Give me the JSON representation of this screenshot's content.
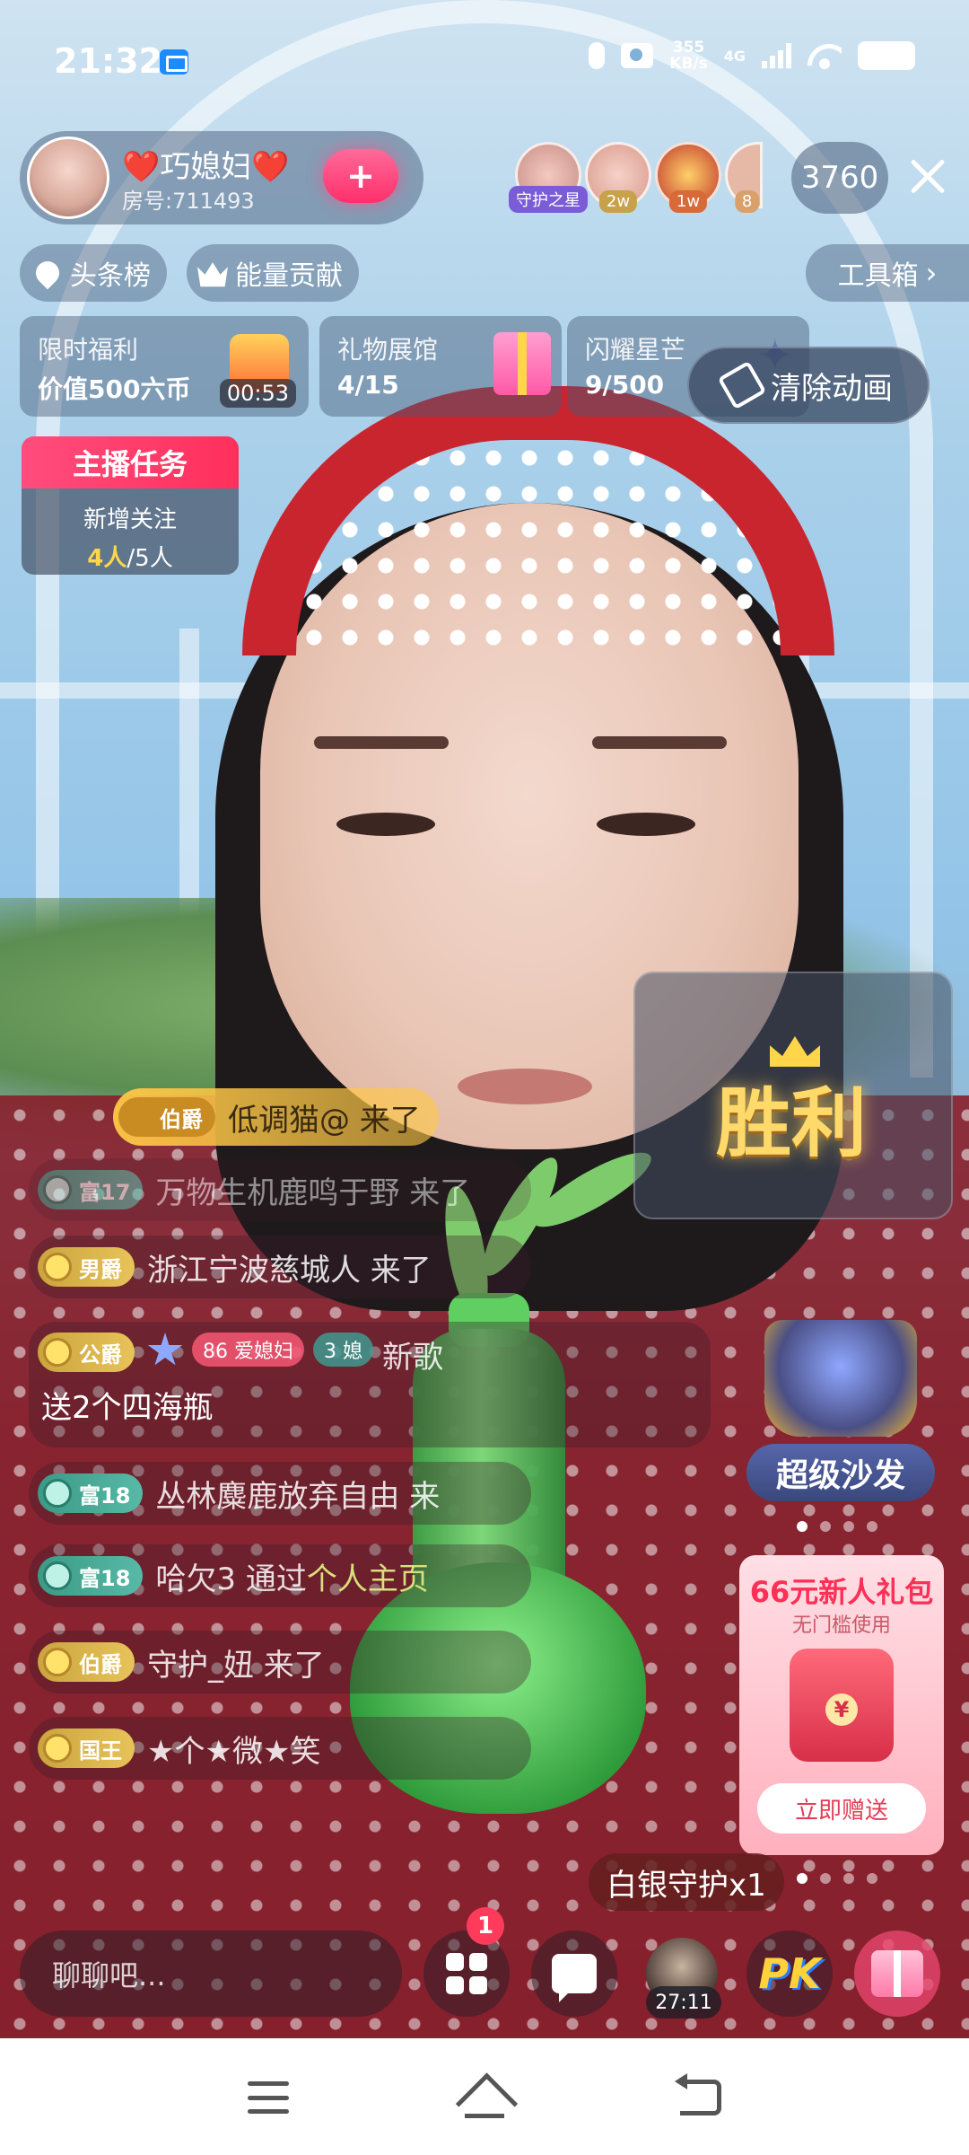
{
  "status_bar": {
    "time": "21:32",
    "net_speed": "355\nKB/s",
    "net_type": "4G",
    "icons": [
      "cast-icon",
      "mic-icon",
      "camera-icon",
      "signal-icon",
      "wifi-icon",
      "battery-icon"
    ]
  },
  "host": {
    "name": "❤️巧媳妇❤️",
    "room_id": "房号:711493",
    "follow_label": "+"
  },
  "top_viewers": [
    {
      "badge": "守护之星",
      "color": "#7a5cd6"
    },
    {
      "badge": "2w",
      "color": "#c7a24a"
    },
    {
      "badge": "1w",
      "color": "#d86a3a"
    },
    {
      "badge": "8",
      "color": "#d9a06a"
    }
  ],
  "viewer_count": "3760",
  "rank_row": {
    "headline": "头条榜",
    "energy": "能量贡献",
    "toolbox": "工具箱"
  },
  "cards": [
    {
      "title": "限时福利",
      "sub": "价值500六币",
      "timer": "00:53"
    },
    {
      "title": "礼物展馆",
      "sub": "4/15"
    },
    {
      "title": "闪耀星芒",
      "sub": "9/500"
    }
  ],
  "clear_animation": "清除动画",
  "host_task": {
    "title": "主播任务",
    "label": "新增关注",
    "progress_current": "4人",
    "progress_total": "/5人"
  },
  "victory": "胜利",
  "arrival": {
    "level": "伯爵",
    "text": "低调猫@ 来了"
  },
  "chat": [
    {
      "level": "富17",
      "style": "teal",
      "text": "万物生机鹿鸣于野 来了"
    },
    {
      "level": "男爵",
      "style": "gold",
      "text": "浙江宁波慈城人 来了"
    },
    {
      "level": "公爵",
      "style": "gold",
      "fan1": "86 爱媳妇",
      "fan2": "3 媳",
      "text": "新歌"
    },
    {
      "level": "富18",
      "style": "teal",
      "text": "丛林麋鹿放弃自由 来"
    },
    {
      "level": "富18",
      "style": "teal",
      "text": "哈欠3 通过 ",
      "extra": "个人主页"
    },
    {
      "level": "伯爵",
      "style": "gold",
      "text": "守护_妞 来了"
    },
    {
      "level": "国王",
      "style": "gold",
      "text": "★个★微★笑"
    }
  ],
  "gift_line": "送2个四海瓶",
  "sofa_label": "超级沙发",
  "promo": {
    "title": "66元新人礼包",
    "sub": "无门槛使用",
    "button": "立即赠送"
  },
  "guard_toast": "白银守护x1",
  "bottom": {
    "chat_placeholder": "聊聊吧...",
    "more_badge": "1",
    "guard_timer": "27:11",
    "pk_label": "PK"
  }
}
